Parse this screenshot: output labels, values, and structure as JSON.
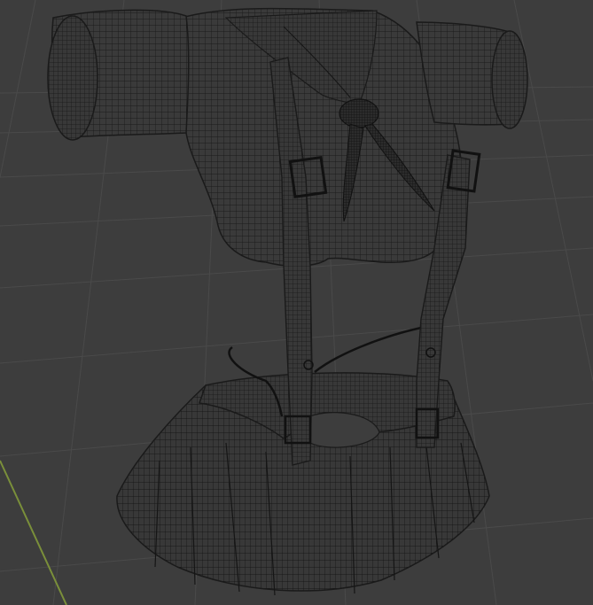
{
  "viewport": {
    "view_mode": "wireframe",
    "colors": {
      "background": "#3d3d3d",
      "grid_line": "#4a4a4a",
      "x_axis": "#7a8f3a",
      "wire": "#1a1a1a",
      "surface": "#3a3a3a"
    }
  },
  "model": {
    "parts": [
      "shirt",
      "sleeve-left",
      "sleeve-right",
      "neckerchief",
      "suspender-left",
      "suspender-right",
      "skirt-waistband",
      "skirt-pleats",
      "drawstring"
    ]
  }
}
